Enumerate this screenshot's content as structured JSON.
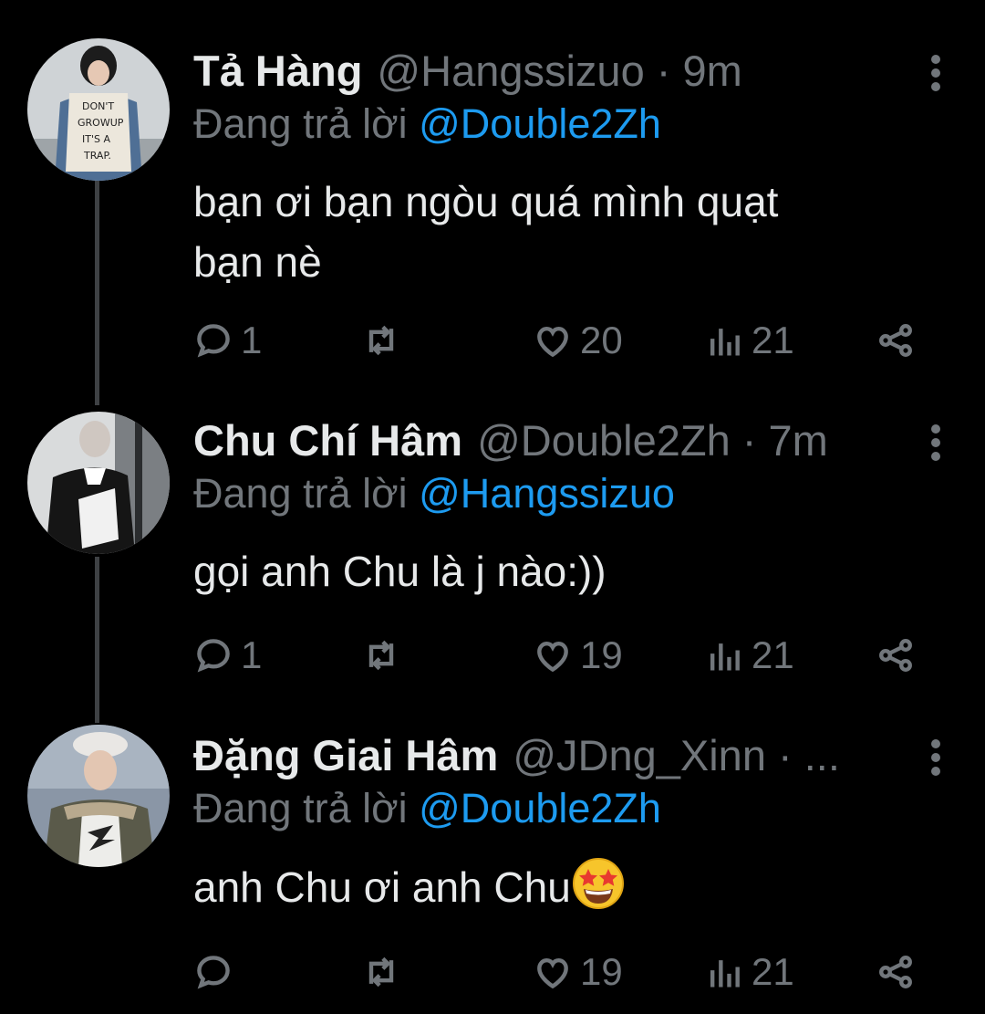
{
  "tweets": [
    {
      "name": "Tả Hàng",
      "handle_time": "@Hangssizuo · 9m",
      "replying_prefix": "Đang trả lời",
      "replying_to": "@Double2Zh",
      "body_lines": [
        "bạn ơi bạn ngòu quá mình quạt",
        "bạn nè"
      ],
      "avatar_text": [
        "DON'T",
        "GROWUP",
        "IT'S A",
        "TRAP."
      ],
      "stats": {
        "replies": "1",
        "retweets": "",
        "likes": "20",
        "views": "21"
      }
    },
    {
      "name": "Chu Chí Hâm",
      "handle_time": "@Double2Zh · 7m",
      "replying_prefix": "Đang trả lời",
      "replying_to": "@Hangssizuo",
      "body_lines": [
        "gọi anh Chu là j nào:))"
      ],
      "stats": {
        "replies": "1",
        "retweets": "",
        "likes": "19",
        "views": "21"
      }
    },
    {
      "name": "Đặng Giai Hâm",
      "handle_time": "@JDng_Xinn · ...",
      "replying_prefix": "Đang trả lời",
      "replying_to": "@Double2Zh",
      "body_lines": [
        "anh Chu ơi anh Chu"
      ],
      "body_emoji": "star-struck-emoji",
      "stats": {
        "replies": "",
        "retweets": "",
        "likes": "19",
        "views": "21"
      }
    }
  ],
  "colors": {
    "background": "#000000",
    "text": "#e7e9ea",
    "secondary": "#71767b",
    "mention": "#1d9bf0",
    "thread_line": "#3e4144"
  },
  "icons": [
    "reply-icon",
    "retweet-icon",
    "like-icon",
    "views-icon",
    "share-icon",
    "more-icon"
  ]
}
